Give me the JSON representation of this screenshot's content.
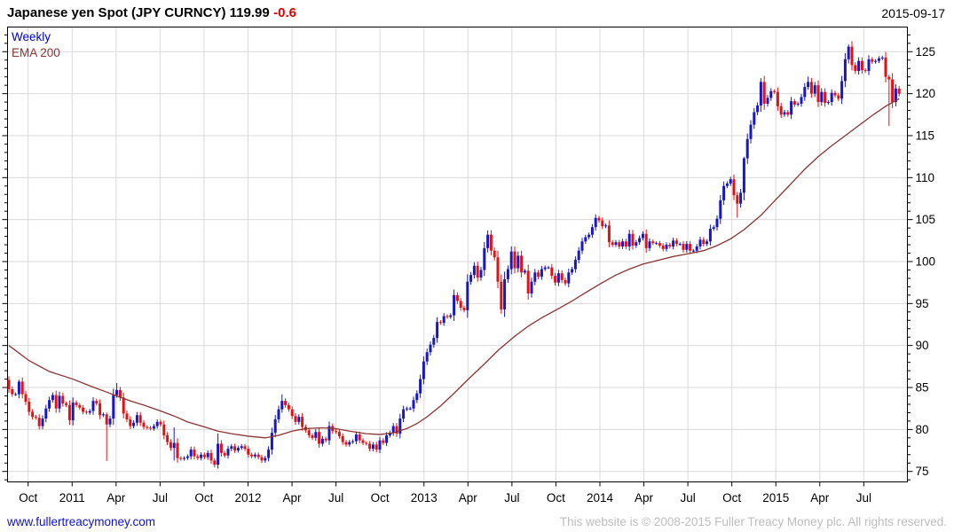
{
  "header": {
    "title": "Japanese yen Spot (JPY CURNCY) 119.99",
    "change": "-0.6",
    "date": "2015-09-17"
  },
  "legend": {
    "weekly": "Weekly",
    "ema": "EMA 200"
  },
  "footer": {
    "link": "www.fullertreacymoney.com",
    "copyright": "This website is © 2008-2015 Fuller Treacy Money plc. All rights reserved."
  },
  "colors": {
    "up_candle": "#1717c3",
    "down_candle": "#e31212",
    "ema_line": "#8b3333",
    "grid": "#d9d9d9",
    "axis": "#000000",
    "title_change": "#e00000",
    "legend_weekly": "#0000cc",
    "footer_link": "#1010d0",
    "footer_copyright": "#bdbdbd"
  },
  "chart_data": {
    "type": "candlestick",
    "timeframe": "weekly",
    "instrument": "Japanese yen Spot (JPY CURNCY)",
    "last_price": 119.99,
    "last_change": -0.6,
    "as_of_date": "2015-09-17",
    "start_week": "2010-08-23",
    "end_week": "2015-09-14",
    "x_tick_labels": [
      "Oct",
      "2011",
      "Apr",
      "Jul",
      "Oct",
      "2012",
      "Apr",
      "Jul",
      "Oct",
      "2013",
      "Apr",
      "Jul",
      "Oct",
      "2014",
      "Apr",
      "Jul",
      "Oct",
      "2015",
      "Apr",
      "Jul"
    ],
    "y_ticks": [
      75,
      80,
      85,
      90,
      95,
      100,
      105,
      110,
      115,
      120,
      125
    ],
    "ylim": [
      73.7,
      128.0
    ],
    "grid": true,
    "first_open": 85.9,
    "closes": [
      84.8,
      84.2,
      84.2,
      85.7,
      84.2,
      83.3,
      82.1,
      81.5,
      81.4,
      80.4,
      81.3,
      82.5,
      83.5,
      84.1,
      82.5,
      84.0,
      83.1,
      82.9,
      81.1,
      83.2,
      82.9,
      82.6,
      82.1,
      82.0,
      82.2,
      83.4,
      83.1,
      81.7,
      81.8,
      80.6,
      81.3,
      84.1,
      84.7,
      83.8,
      81.9,
      81.2,
      80.4,
      80.8,
      81.7,
      80.8,
      80.3,
      80.2,
      80.1,
      80.4,
      80.9,
      80.6,
      79.3,
      78.5,
      77.8,
      78.4,
      76.6,
      76.5,
      76.6,
      76.8,
      77.6,
      76.8,
      76.6,
      77.0,
      76.7,
      77.2,
      76.3,
      75.8,
      78.3,
      77.2,
      76.9,
      77.7,
      78.0,
      77.5,
      77.8,
      78.0,
      77.7,
      77.0,
      76.8,
      77.0,
      76.7,
      76.3,
      76.6,
      77.6,
      79.6,
      81.2,
      82.4,
      83.4,
      82.9,
      82.4,
      81.6,
      80.9,
      81.5,
      80.3,
      79.9,
      79.3,
      79.0,
      79.7,
      78.3,
      78.9,
      78.7,
      80.4,
      79.8,
      79.7,
      79.2,
      78.5,
      78.2,
      78.5,
      78.6,
      79.4,
      78.7,
      78.4,
      78.3,
      77.7,
      78.2,
      77.6,
      78.7,
      78.4,
      79.3,
      79.6,
      80.4,
      79.5,
      81.3,
      82.4,
      82.5,
      82.5,
      83.5,
      84.3,
      86.0,
      88.1,
      89.2,
      90.1,
      90.9,
      92.8,
      92.7,
      93.5,
      93.4,
      93.6,
      96.0,
      95.3,
      94.5,
      94.2,
      97.6,
      98.4,
      99.5,
      98.1,
      99.0,
      101.6,
      103.2,
      101.3,
      100.5,
      97.6,
      94.3,
      97.9,
      99.1,
      101.2,
      99.2,
      100.7,
      98.7,
      98.9,
      96.2,
      97.6,
      98.7,
      98.2,
      99.1,
      99.3,
      99.3,
      98.3,
      97.5,
      98.6,
      97.8,
      97.4,
      98.7,
      99.1,
      100.2,
      101.3,
      102.4,
      102.9,
      103.2,
      104.1,
      105.2,
      104.9,
      104.2,
      104.3,
      102.3,
      102.0,
      102.3,
      101.8,
      102.4,
      101.8,
      103.3,
      101.9,
      102.3,
      102.8,
      103.3,
      101.6,
      102.4,
      102.2,
      102.2,
      101.9,
      101.5,
      102.0,
      101.8,
      102.5,
      102.1,
      102.1,
      101.4,
      102.1,
      101.3,
      101.3,
      101.8,
      102.6,
      102.1,
      102.4,
      103.9,
      104.1,
      105.1,
      107.3,
      109.0,
      109.3,
      109.8,
      107.9,
      106.9,
      108.2,
      112.3,
      114.6,
      116.3,
      117.8,
      118.6,
      121.4,
      118.8,
      119.5,
      120.3,
      120.2,
      118.5,
      117.5,
      117.8,
      117.5,
      119.1,
      118.7,
      118.8,
      119.6,
      120.8,
      121.4,
      120.0,
      121.0,
      119.0,
      120.2,
      118.9,
      119.0,
      120.1,
      119.8,
      119.4,
      121.5,
      124.1,
      125.6,
      123.4,
      122.7,
      123.9,
      122.8,
      122.7,
      124.1,
      123.8,
      123.9,
      124.2,
      124.3,
      122.0,
      121.7,
      119.0,
      120.6,
      119.99
    ],
    "wick_overrides": {
      "3": [
        85.93,
        null
      ],
      "29": [
        82.0,
        76.25
      ],
      "32": [
        85.53,
        null
      ],
      "49": [
        80.24,
        76.3
      ],
      "62": [
        79.53,
        75.35
      ],
      "81": [
        84.18,
        null
      ],
      "143": [
        103.74,
        null
      ],
      "146": [
        null,
        93.79
      ],
      "175": [
        105.44,
        null
      ],
      "216": [
        null,
        105.23
      ],
      "218": [
        112.48,
        null
      ],
      "223": [
        121.85,
        null
      ],
      "237": [
        122.04,
        null
      ],
      "249": [
        125.86,
        null
      ],
      "261": [
        null,
        116.15
      ]
    },
    "ema200": [
      [
        0,
        90.0
      ],
      [
        6,
        88.2
      ],
      [
        12,
        86.9
      ],
      [
        19,
        86.0
      ],
      [
        24,
        85.2
      ],
      [
        28,
        84.6
      ],
      [
        32,
        84.0
      ],
      [
        36,
        83.4
      ],
      [
        40,
        82.9
      ],
      [
        45,
        82.2
      ],
      [
        49,
        81.6
      ],
      [
        53,
        80.9
      ],
      [
        58,
        80.3
      ],
      [
        62,
        79.8
      ],
      [
        66,
        79.5
      ],
      [
        71,
        79.2
      ],
      [
        76,
        79.0
      ],
      [
        80,
        79.3
      ],
      [
        84,
        79.8
      ],
      [
        88,
        80.1
      ],
      [
        93,
        80.2
      ],
      [
        97,
        80.1
      ],
      [
        101,
        79.8
      ],
      [
        106,
        79.5
      ],
      [
        110,
        79.4
      ],
      [
        114,
        79.6
      ],
      [
        118,
        80.1
      ],
      [
        121,
        80.7
      ],
      [
        124,
        81.5
      ],
      [
        128,
        82.8
      ],
      [
        132,
        84.3
      ],
      [
        136,
        85.9
      ],
      [
        141,
        87.8
      ],
      [
        145,
        89.4
      ],
      [
        150,
        91.1
      ],
      [
        154,
        92.3
      ],
      [
        158,
        93.3
      ],
      [
        163,
        94.4
      ],
      [
        167,
        95.3
      ],
      [
        171,
        96.3
      ],
      [
        176,
        97.5
      ],
      [
        180,
        98.4
      ],
      [
        184,
        99.1
      ],
      [
        188,
        99.7
      ],
      [
        193,
        100.2
      ],
      [
        197,
        100.6
      ],
      [
        201,
        100.9
      ],
      [
        206,
        101.3
      ],
      [
        210,
        101.9
      ],
      [
        214,
        102.7
      ],
      [
        218,
        103.8
      ],
      [
        223,
        105.5
      ],
      [
        227,
        107.2
      ],
      [
        232,
        109.3
      ],
      [
        236,
        111.0
      ],
      [
        240,
        112.5
      ],
      [
        244,
        113.8
      ],
      [
        248,
        115.0
      ],
      [
        252,
        116.2
      ],
      [
        256,
        117.4
      ],
      [
        260,
        118.5
      ],
      [
        264,
        119.4
      ]
    ]
  }
}
